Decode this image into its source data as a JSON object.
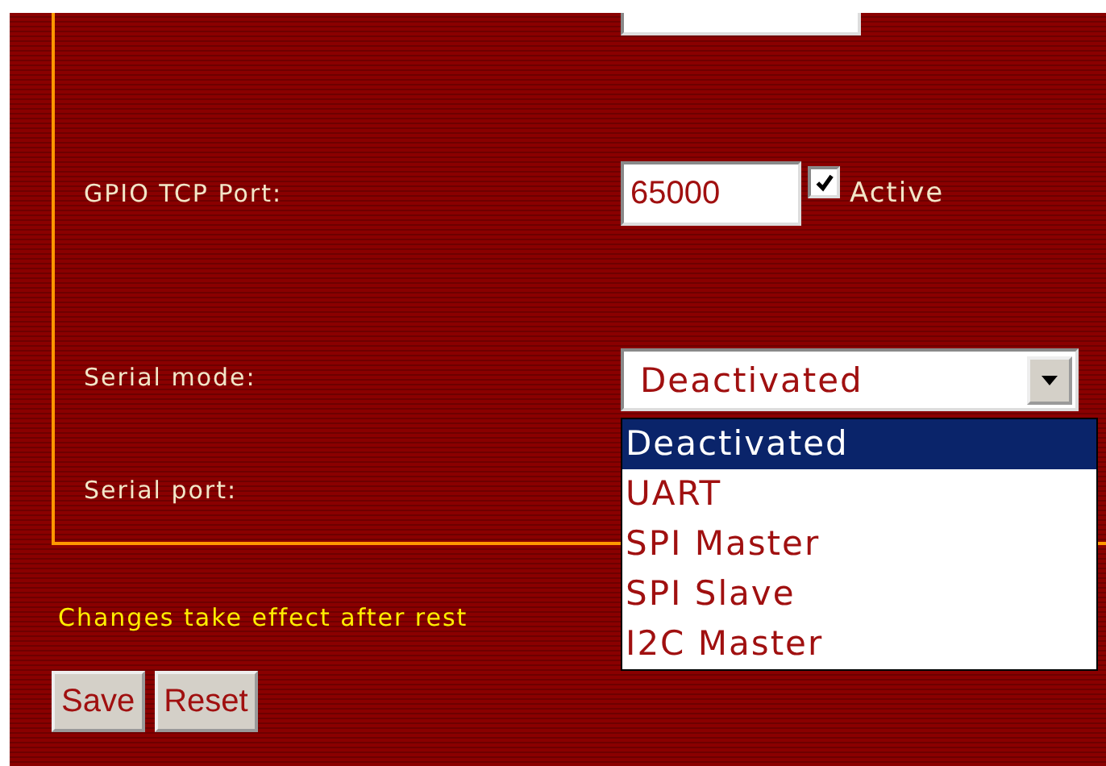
{
  "gpio_tcp_port": {
    "label": "GPIO TCP Port:",
    "value": "65000",
    "active": {
      "label": "Active",
      "checked": true
    }
  },
  "serial_mode": {
    "label": "Serial mode:",
    "value": "Deactivated",
    "expanded": true,
    "options": [
      {
        "label": "Deactivated",
        "selected": true
      },
      {
        "label": "UART",
        "selected": false
      },
      {
        "label": "SPI Master",
        "selected": false
      },
      {
        "label": "SPI Slave",
        "selected": false
      },
      {
        "label": "I2C Master",
        "selected": false
      }
    ]
  },
  "serial_port": {
    "label": "Serial port:"
  },
  "notice": "Changes take effect after rest",
  "buttons": [
    "Save",
    "Reset"
  ]
}
